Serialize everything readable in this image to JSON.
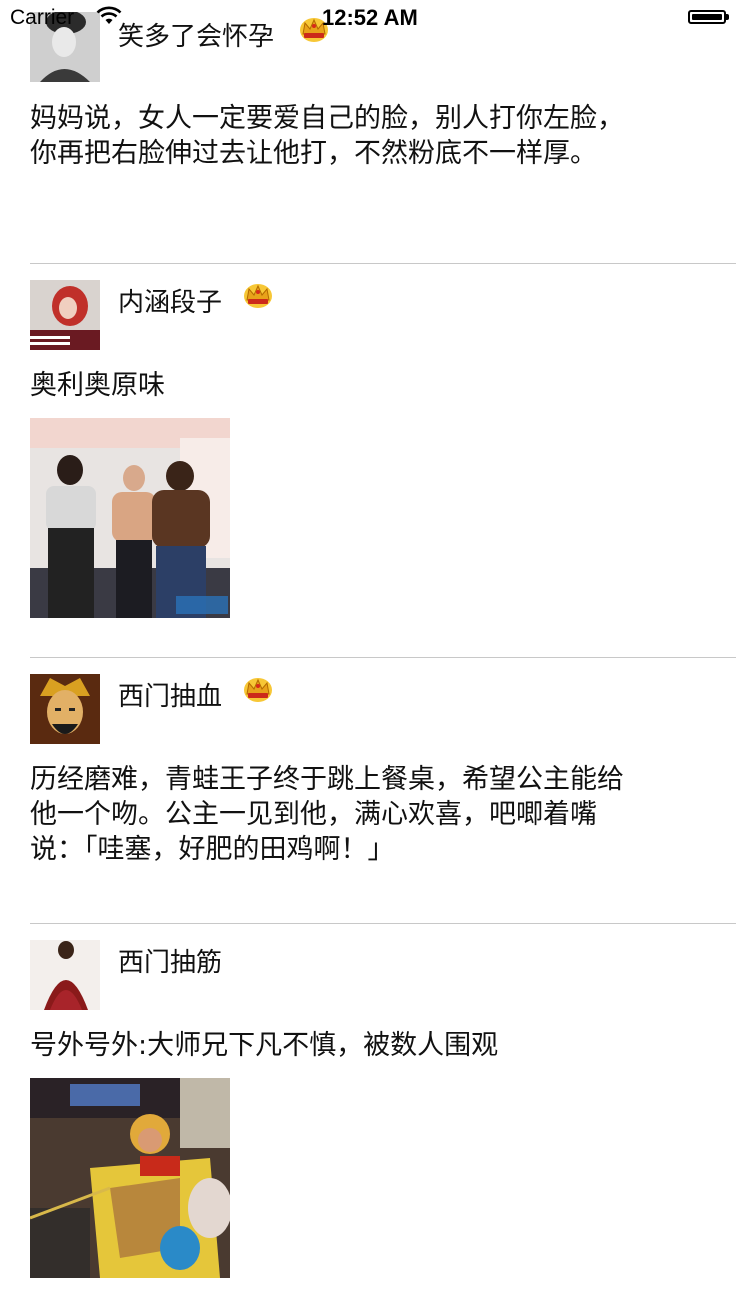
{
  "status_bar": {
    "carrier": "Carrier",
    "time": "12:52 AM"
  },
  "posts": [
    {
      "username": "笑多了会怀孕",
      "vip": true,
      "text": "妈妈说，女人一定要爱自己的脸，别人打你左脸，你再把右脸伸过去让他打，不然粉底不一样厚。",
      "has_image": false
    },
    {
      "username": "内涵段子",
      "vip": true,
      "text": "奥利奥原味",
      "has_image": true
    },
    {
      "username": "西门抽血",
      "vip": true,
      "text": "历经磨难，青蛙王子终于跳上餐桌，希望公主能给他一个吻。公主一见到他，满心欢喜，吧唧着嘴说：「哇塞，好肥的田鸡啊！」",
      "has_image": false
    },
    {
      "username": "西门抽筋",
      "vip": false,
      "text": "号外号外:大师兄下凡不慎，被数人围观",
      "has_image": true
    }
  ]
}
